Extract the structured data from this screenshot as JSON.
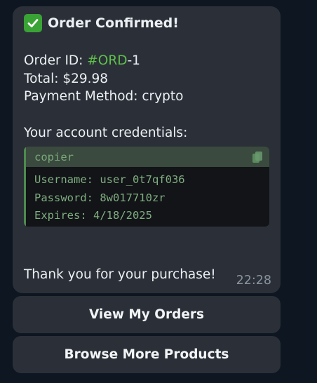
{
  "message": {
    "title": "Order Confirmed!",
    "order_id_label": "Order ID: ",
    "order_id_link": "#ORD",
    "order_id_suffix": "-1",
    "total": "Total: $29.98",
    "payment_method": "Payment Method: crypto",
    "credentials_heading": "Your account credentials:",
    "code_block": {
      "language": "copier",
      "lines": [
        "Username: user_0t7qf036",
        "Password: 8w017710zr",
        "Expires: 4/18/2025"
      ]
    },
    "thanks": "Thank you for your purchase!",
    "time": "22:28"
  },
  "keyboard": {
    "view_orders_label": "View My Orders",
    "browse_label": "Browse More Products"
  },
  "icons": {
    "title_icon": "check-mark-button-icon",
    "copy_icon": "copy-icon"
  },
  "colors": {
    "bubble": "#2b3038",
    "link": "#5fc14b",
    "code_text": "#7fae7f",
    "check_green": "#3aa335"
  }
}
